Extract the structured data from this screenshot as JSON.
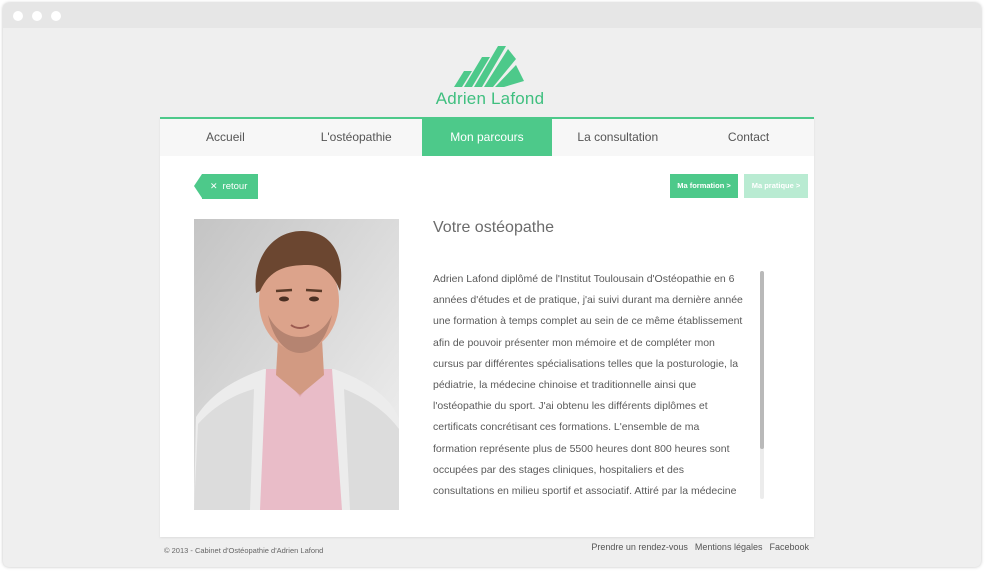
{
  "window": {
    "controls": [
      "window-dot",
      "window-dot",
      "window-dot"
    ]
  },
  "brand": {
    "name": "Adrien Lafond",
    "logo_icon": "stacked-slanted-bars-logo",
    "color": "#4dc98a"
  },
  "nav": {
    "items": [
      {
        "label": "Accueil",
        "active": false
      },
      {
        "label": "L'ostéopathie",
        "active": false
      },
      {
        "label": "Mon parcours",
        "active": true
      },
      {
        "label": "La consultation",
        "active": false
      },
      {
        "label": "Contact",
        "active": false
      }
    ]
  },
  "content": {
    "back_label": "retour",
    "back_icon": "close-icon",
    "tabs": [
      {
        "label": "Ma formation >",
        "active": true,
        "color": "#4dc98a"
      },
      {
        "label": "Ma pratique >",
        "active": false,
        "color": "#b9ebd2"
      }
    ],
    "title": "Votre ostéopathe",
    "paragraph": "Adrien Lafond diplômé de l'Institut Toulousain d'Ostéopathie en 6 années d'études et de pratique, j'ai suivi durant ma dernière année une formation à temps complet au sein de ce même établissement afin de pouvoir présenter mon mémoire et de compléter mon cursus par différentes spécialisations telles que la posturologie, la pédiatrie, la médecine chinoise et traditionnelle ainsi que l'ostéopathie du sport. J'ai obtenu les différents diplômes et certificats concrétisant ces formations. L'ensemble de ma formation représente plus de 5500 heures dont 800 heures sont occupées par des stages cliniques, hospitaliers et des consultations en milieu sportif et associatif. Attiré par la médecine"
  },
  "footer": {
    "copyright": "© 2013 - Cabinet d'Ostéopathie d'Adrien Lafond",
    "links": [
      "Prendre un rendez-vous",
      "Mentions légales",
      "Facebook"
    ]
  }
}
